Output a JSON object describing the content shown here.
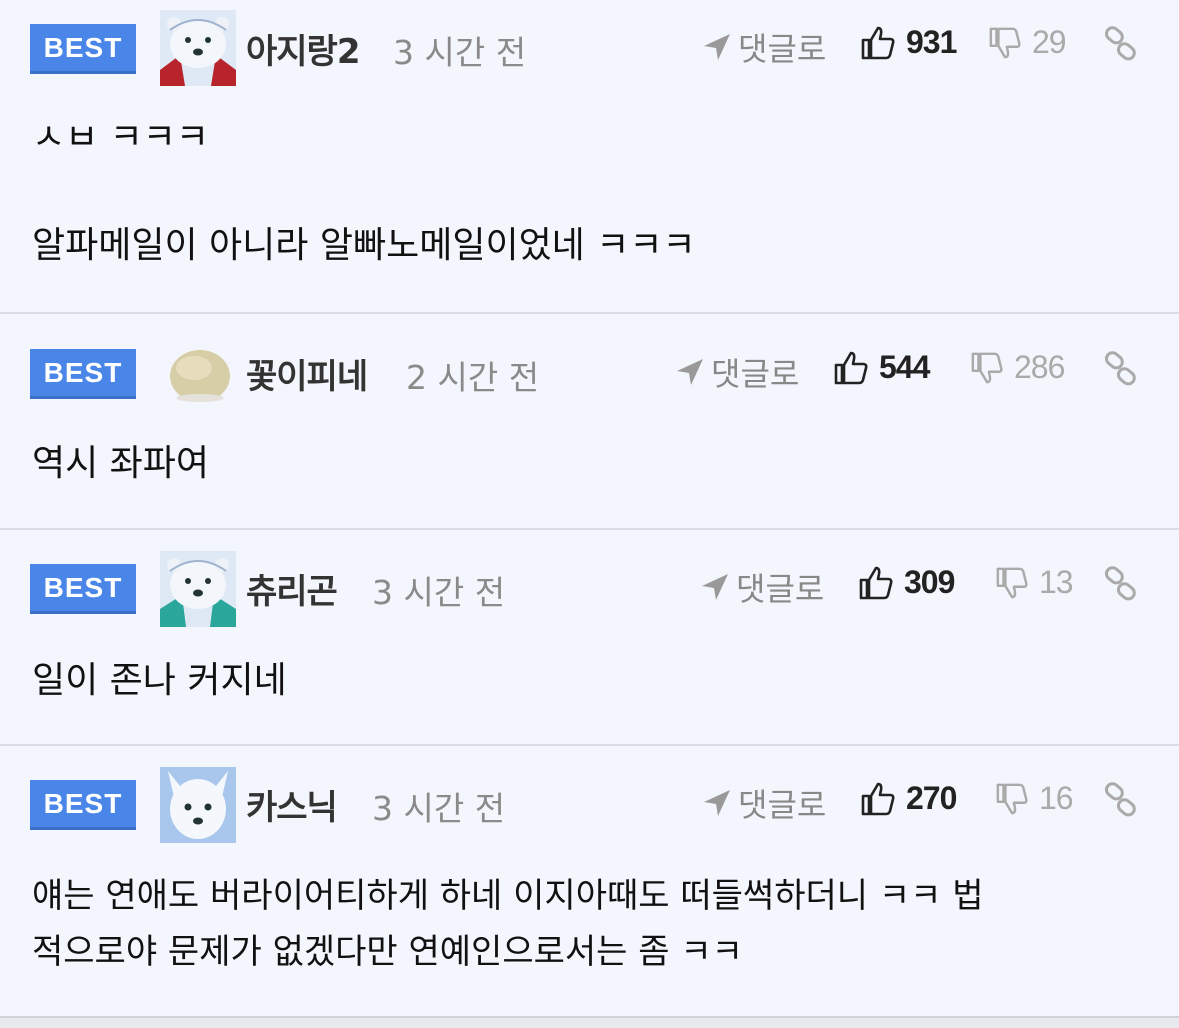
{
  "comments": [
    {
      "badge": "BEST",
      "nickname": "아지랑2",
      "time": "3 시간 전",
      "reply_label": "댓글로",
      "likes": "931",
      "dislikes": "29",
      "lines": [
        "ㅅㅂ ㅋㅋㅋ",
        "알파메일이 아니라 알빠노메일이었네 ㅋㅋㅋ"
      ],
      "avatar_icon": "polar-bear-avatar-icon"
    },
    {
      "badge": "BEST",
      "nickname": "꽃이피네",
      "time": "2 시간 전",
      "reply_label": "댓글로",
      "likes": "544",
      "dislikes": "286",
      "lines": [
        "역시 좌파여"
      ],
      "avatar_icon": "blob-avatar-icon"
    },
    {
      "badge": "BEST",
      "nickname": "츄리곤",
      "time": "3 시간 전",
      "reply_label": "댓글로",
      "likes": "309",
      "dislikes": "13",
      "lines": [
        "일이 존나 커지네"
      ],
      "avatar_icon": "polar-bear-avatar-icon"
    },
    {
      "badge": "BEST",
      "nickname": "카스닉",
      "time": "3 시간 전",
      "reply_label": "댓글로",
      "likes": "270",
      "dislikes": "16",
      "lines": [
        "얘는 연애도 버라이어티하게 하네 이지아때도 떠들썩하더니 ㅋㅋ 법",
        "적으로야 문제가 없겠다만 연예인으로서는 좀 ㅋㅋ"
      ],
      "avatar_icon": "arctic-fox-avatar-icon"
    }
  ],
  "colors": {
    "badge": "#4a86e8",
    "background": "#f4f6fd"
  }
}
